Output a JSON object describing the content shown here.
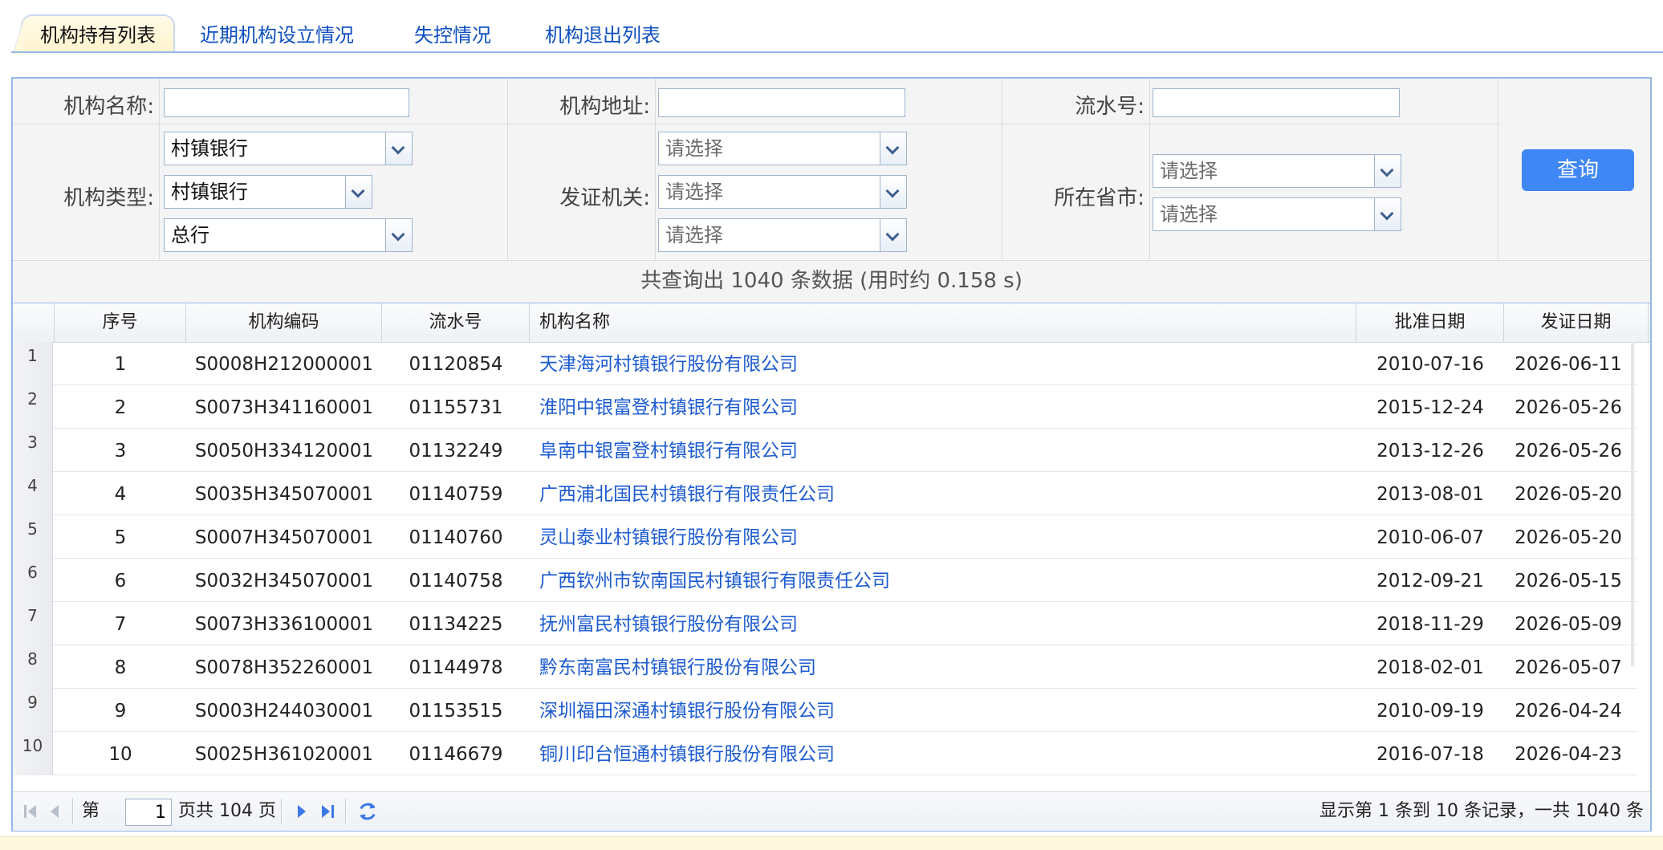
{
  "tabs": [
    "机构持有列表",
    "近期机构设立情况",
    "失控情况",
    "机构退出列表"
  ],
  "form": {
    "name_label": "机构名称:",
    "name_value": "",
    "address_label": "机构地址:",
    "address_value": "",
    "serial_label": "流水号:",
    "serial_value": "",
    "type_label": "机构类型:",
    "type_values": [
      "村镇银行",
      "村镇银行",
      "总行"
    ],
    "issuer_label": "发证机关:",
    "issuer_values": [
      "请选择",
      "请选择",
      "请选择"
    ],
    "province_label": "所在省市:",
    "province_values": [
      "请选择",
      "请选择"
    ],
    "query_label": "查询"
  },
  "summary": "共查询出 1040 条数据 (用时约 0.158 s)",
  "grid": {
    "headers": [
      "序号",
      "机构编码",
      "流水号",
      "机构名称",
      "批准日期",
      "发证日期"
    ],
    "rows": [
      [
        "1",
        "1",
        "S0008H212000001",
        "01120854",
        "天津海河村镇银行股份有限公司",
        "2010-07-16",
        "2026-06-11"
      ],
      [
        "2",
        "2",
        "S0073H341160001",
        "01155731",
        "淮阳中银富登村镇银行有限公司",
        "2015-12-24",
        "2026-05-26"
      ],
      [
        "3",
        "3",
        "S0050H334120001",
        "01132249",
        "阜南中银富登村镇银行有限公司",
        "2013-12-26",
        "2026-05-26"
      ],
      [
        "4",
        "4",
        "S0035H345070001",
        "01140759",
        "广西浦北国民村镇银行有限责任公司",
        "2013-08-01",
        "2026-05-20"
      ],
      [
        "5",
        "5",
        "S0007H345070001",
        "01140760",
        "灵山泰业村镇银行股份有限公司",
        "2010-06-07",
        "2026-05-20"
      ],
      [
        "6",
        "6",
        "S0032H345070001",
        "01140758",
        "广西钦州市钦南国民村镇银行有限责任公司",
        "2012-09-21",
        "2026-05-15"
      ],
      [
        "7",
        "7",
        "S0073H336100001",
        "01134225",
        "抚州富民村镇银行股份有限公司",
        "2018-11-29",
        "2026-05-09"
      ],
      [
        "8",
        "8",
        "S0078H352260001",
        "01144978",
        "黔东南富民村镇银行股份有限公司",
        "2018-02-01",
        "2026-05-07"
      ],
      [
        "9",
        "9",
        "S0003H244030001",
        "01153515",
        "深圳福田深通村镇银行股份有限公司",
        "2010-09-19",
        "2026-04-24"
      ],
      [
        "10",
        "10",
        "S0025H361020001",
        "01146679",
        "铜川印台恒通村镇银行股份有限公司",
        "2016-07-18",
        "2026-04-23"
      ]
    ]
  },
  "pager": {
    "page_prefix": "第",
    "page_value": "1",
    "page_suffix": "页共 104 页",
    "record_info": "显示第 1 条到 10 条记录，一共 1040 条"
  },
  "icons": {
    "first": "first-page-icon",
    "prev": "prev-page-icon",
    "next": "next-page-icon",
    "last": "last-page-icon",
    "refresh": "refresh-icon"
  },
  "colors": {
    "accent": "#3f87f5",
    "link": "#1c5bd0",
    "border": "#95b8e7"
  }
}
